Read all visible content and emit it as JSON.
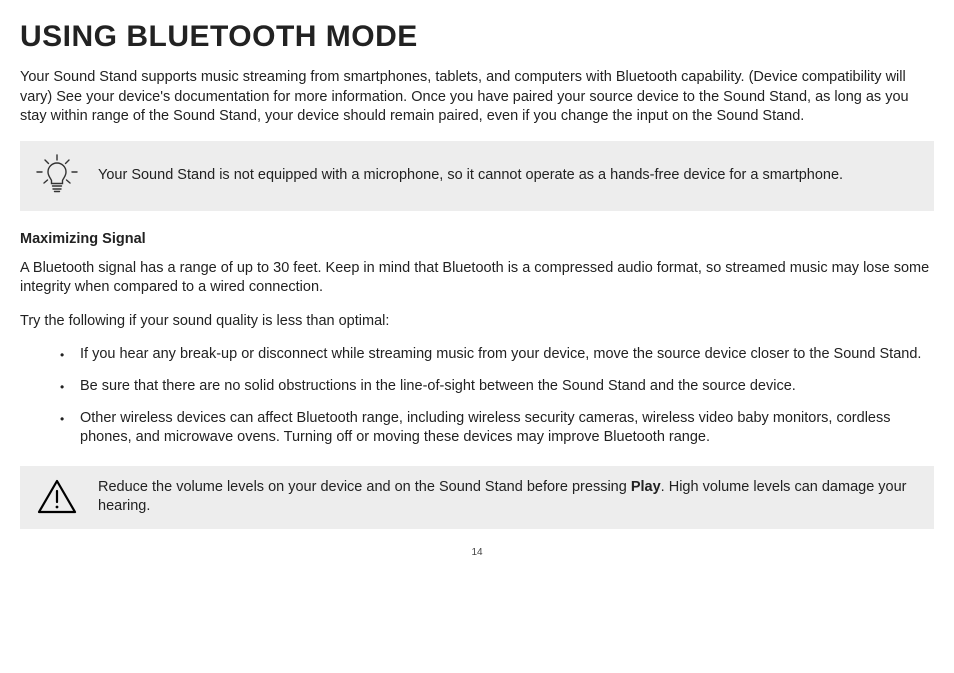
{
  "title": "USING BLUETOOTH MODE",
  "intro": "Your Sound Stand supports music streaming from smartphones, tablets, and computers with Bluetooth capability. (Device compatibility will vary) See your device's documentation for more information. Once you have paired your source device to the Sound Stand, as long as you stay within range of the Sound Stand, your device should remain paired, even if you change the input on the Sound Stand.",
  "tip": "Your Sound Stand is not equipped with a microphone, so it cannot operate as a hands-free device for a smartphone.",
  "section_heading": "Maximizing Signal",
  "signal_intro": "A Bluetooth signal has a range of up to 30 feet.  Keep in mind that Bluetooth is a compressed audio format, so streamed music may lose some integrity when compared to a wired connection.",
  "try_intro": "Try the following if your sound quality is less than optimal:",
  "bullets": [
    "If you hear any break-up or disconnect while streaming music from your device, move the source device closer to the Sound Stand.",
    "Be sure that there are no solid obstructions in the line-of-sight between the Sound Stand and the source device.",
    "Other wireless devices can affect Bluetooth range, including wireless security cameras, wireless video baby monitors, cordless phones, and microwave ovens.  Turning off or moving these devices may improve Bluetooth range."
  ],
  "warning_pre": "Reduce the volume levels on your device and on the Sound Stand before pressing ",
  "warning_bold": "Play",
  "warning_post": ". High volume levels can damage your hearing.",
  "page_number": "14"
}
